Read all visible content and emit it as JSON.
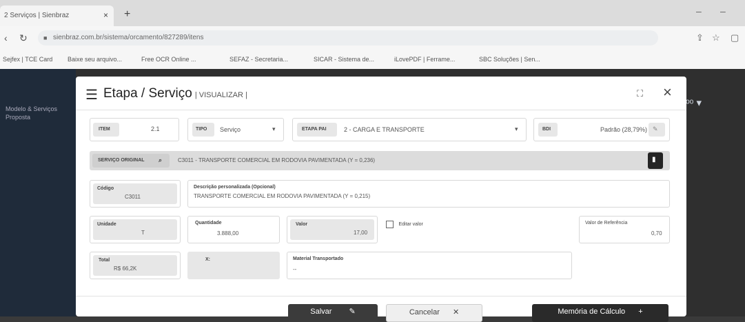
{
  "browser": {
    "tab_title": "2 Serviços | Sienbraz",
    "url": "sienbraz.com.br/sistema/orcamento/827289/itens",
    "bookmarks": [
      "Sejfex | TCE Card",
      "Baixe seu arquivo...",
      "Free OCR Online ...",
      "SEFAZ - Secretaria...",
      "SICAR - Sistema de...",
      "iLovePDF | Ferrame...",
      "SBC Soluções | Sen..."
    ]
  },
  "sidebar": {
    "label": "Modelo & Serviços Proposta"
  },
  "modal": {
    "title": "Etapa / Serviço",
    "subtitle": "| VISUALIZAR |",
    "item": {
      "label": "ITEM",
      "value": "2.1"
    },
    "tipo": {
      "label": "TIPO",
      "value": "Serviço"
    },
    "etapa": {
      "label": "ETAPA PAI",
      "value": "2 - CARGA E TRANSPORTE"
    },
    "bdi": {
      "label": "BDI",
      "value": "Padrão (28,79%)"
    },
    "composicao": {
      "label": "SERVIÇO ORIGINAL",
      "value": "C3011 - TRANSPORTE COMERCIAL EM RODOVIA PAVIMENTADA (Y = 0,236)"
    },
    "codigo": {
      "label": "Código",
      "value": "C3011"
    },
    "descricao": {
      "label": "Descrição personalizada (Opcional)",
      "value": "TRANSPORTE COMERCIAL EM RODOVIA PAVIMENTADA (Y = 0,215)"
    },
    "unidade": {
      "label": "Unidade",
      "value": "T"
    },
    "quantidade": {
      "label": "Quantidade",
      "value": "3.888,00"
    },
    "valor": {
      "label": "Valor",
      "value": "17,00"
    },
    "editar_valor": {
      "label": "Editar valor"
    },
    "valor_referencia": {
      "label": "Valor de Referência",
      "value": "0,70"
    },
    "total": {
      "label": "Total",
      "value": "R$ 66,2K"
    },
    "x_field": {
      "label": "X:"
    },
    "material": {
      "label": "Material Transportado",
      "value": "--"
    },
    "buttons": {
      "salvar": "Salvar",
      "cancelar": "Cancelar",
      "memoria": "Memória de Cálculo"
    }
  }
}
